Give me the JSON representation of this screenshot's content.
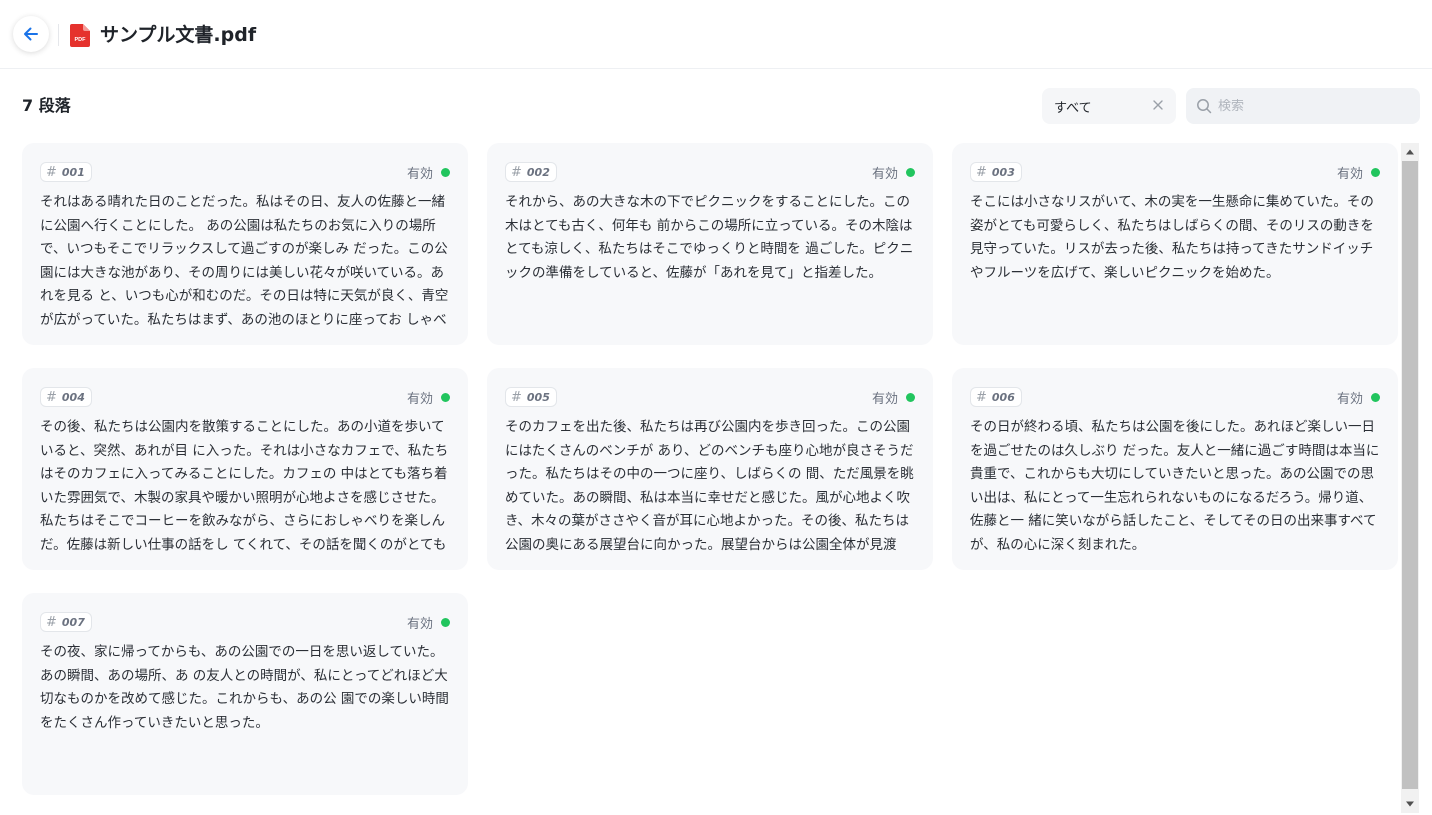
{
  "header": {
    "back_label": "←",
    "file_title": "サンプル文書.pdf",
    "file_icon_text": "PDF",
    "accent": "#1a73e8",
    "pdf_color": "#e5322d"
  },
  "toolbar": {
    "count_label": "7 段落",
    "filter_value": "すべて",
    "search_placeholder": "検索"
  },
  "status_color": "#22c55e",
  "paragraphs": [
    {
      "id": "001",
      "status": "有効",
      "text": "それはある晴れた日のことだった。私はその日、友人の佐藤と一緒に公園へ行くことにした。 あの公園は私たちのお気に入りの場所で、いつもそこでリラックスして過ごすのが楽しみ だった。この公園には大きな池があり、その周りには美しい花々が咲いている。あれを見る と、いつも心が和むのだ。その日は特に天気が良く、青空が広がっていた。私たちはまず、あの池のほとりに座ってお しゃべりを始めた。"
    },
    {
      "id": "002",
      "status": "有効",
      "text": "それから、あの大きな木の下でピクニックをすることにした。この木はとても古く、何年も 前からこの場所に立っている。その木陰はとても涼しく、私たちはそこでゆっくりと時間を 過ごした。ピクニックの準備をしていると、佐藤が「あれを見て」と指差した。"
    },
    {
      "id": "003",
      "status": "有効",
      "text": "そこには小さなリスがいて、木の実を一生懸命に集めていた。その姿がとても可愛らしく、私たちはしばらくの間、そのリスの動きを見守っていた。リスが去った後、私たちは持ってきたサンドイッチやフルーツを広げて、楽しいピクニックを始めた。"
    },
    {
      "id": "004",
      "status": "有効",
      "text": "その後、私たちは公園内を散策することにした。あの小道を歩いていると、突然、あれが目 に入った。それは小さなカフェで、私たちはそのカフェに入ってみることにした。カフェの 中はとても落ち着いた雰囲気で、木製の家具や暖かい照明が心地よさを感じさせた。私たちはそこでコーヒーを飲みながら、さらにおしゃべりを楽しんだ。佐藤は新しい仕事の話をし てくれて、その話を聞くのがとても興味深かった。"
    },
    {
      "id": "005",
      "status": "有効",
      "text": "そのカフェを出た後、私たちは再び公園内を歩き回った。この公園にはたくさんのベンチが あり、どのベンチも座り心地が良さそうだった。私たちはその中の一つに座り、しばらくの 間、ただ風景を眺めていた。あの瞬間、私は本当に幸せだと感じた。風が心地よく吹き、木々の葉がささやく音が耳に心地よかった。その後、私たちは公園の奥にある展望台に向かった。展望台からは公園全体が見渡せ、"
    },
    {
      "id": "006",
      "status": "有効",
      "text": "その日が終わる頃、私たちは公園を後にした。あれほど楽しい一日を過ごせたのは久しぶり だった。友人と一緒に過ごす時間は本当に貴重で、これからも大切にしていきたいと思った。あの公園での思い出は、私にとって一生忘れられないものになるだろう。帰り道、佐藤と一 緒に笑いながら話したこと、そしてその日の出来事すべてが、私の心に深く刻まれた。"
    },
    {
      "id": "007",
      "status": "有効",
      "text": "その夜、家に帰ってからも、あの公園での一日を思い返していた。あの瞬間、あの場所、あ の友人との時間が、私にとってどれほど大切なものかを改めて感じた。これからも、あの公 園での楽しい時間をたくさん作っていきたいと思った。"
    }
  ]
}
